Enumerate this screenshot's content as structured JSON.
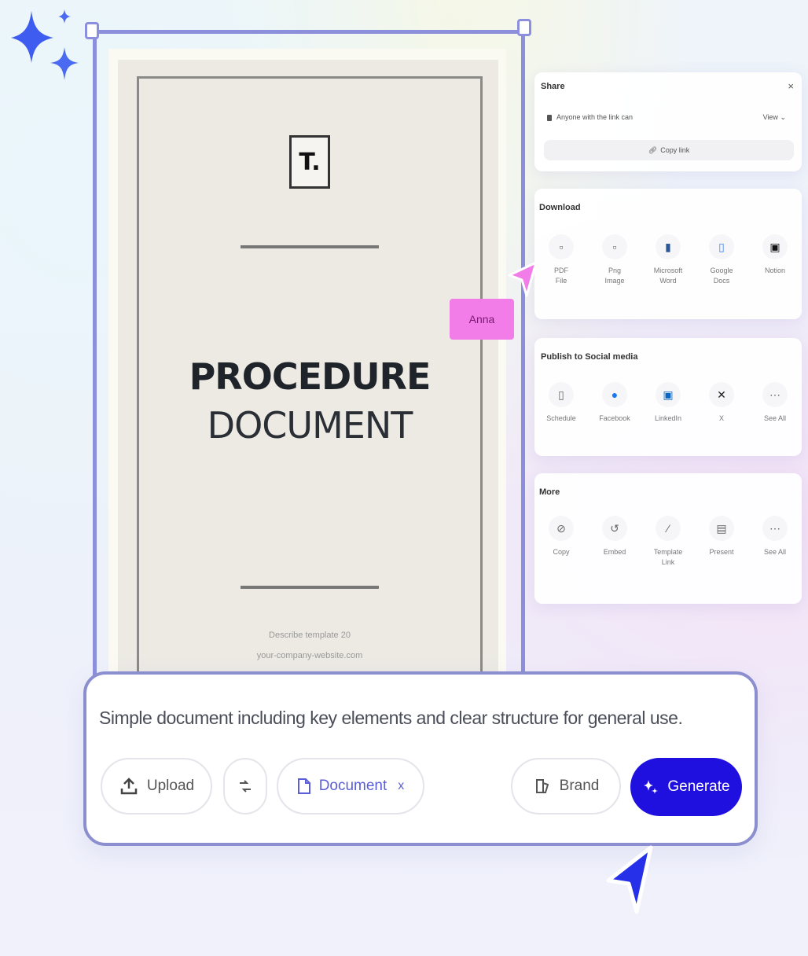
{
  "colors": {
    "accent": "#1f10e0",
    "frame": "#8c8fdc",
    "cursor_pink": "#f27de8",
    "cursor_blue": "#2530e8"
  },
  "document": {
    "logo": "T.",
    "title_line1": "PROCEDURE",
    "title_line2": "DOCUMENT",
    "footer_line1": "Describe template 20",
    "footer_line2": "your-company-website.com"
  },
  "share": {
    "title": "Share",
    "link_text": "Anyone with the link can",
    "permission": "View",
    "copy_link": "Copy link"
  },
  "download": {
    "title": "Download",
    "options": [
      {
        "line1": "PDF",
        "line2": "File",
        "icon": "pdf-icon"
      },
      {
        "line1": "Png",
        "line2": "Image",
        "icon": "image-icon"
      },
      {
        "line1": "Microsoft",
        "line2": "Word",
        "icon": "word-icon"
      },
      {
        "line1": "Google",
        "line2": "Docs",
        "icon": "docs-icon"
      },
      {
        "line1": "Notion",
        "line2": "",
        "icon": "notion-icon"
      }
    ]
  },
  "social": {
    "title": "Publish to Social media",
    "options": [
      {
        "label": "Schedule",
        "icon": "calendar-icon"
      },
      {
        "label": "Facebook",
        "icon": "facebook-icon"
      },
      {
        "label": "LinkedIn",
        "icon": "linkedin-icon"
      },
      {
        "label": "X",
        "icon": "x-icon"
      },
      {
        "label": "See All",
        "icon": "more-icon"
      }
    ]
  },
  "more": {
    "title": "More",
    "options": [
      {
        "line1": "Copy",
        "line2": "",
        "icon": "link-icon"
      },
      {
        "line1": "Embed",
        "line2": "",
        "icon": "embed-icon"
      },
      {
        "line1": "Template",
        "line2": "Link",
        "icon": "template-link-icon"
      },
      {
        "line1": "Present",
        "line2": "",
        "icon": "present-icon"
      },
      {
        "line1": "See All",
        "line2": "",
        "icon": "more-icon"
      }
    ]
  },
  "cursor_tag": "Anna",
  "prompt": {
    "text": "Simple document including key elements and clear structure for general use.",
    "upload": "Upload",
    "document_chip": "Document",
    "document_close": "x",
    "brand": "Brand",
    "generate": "Generate"
  }
}
